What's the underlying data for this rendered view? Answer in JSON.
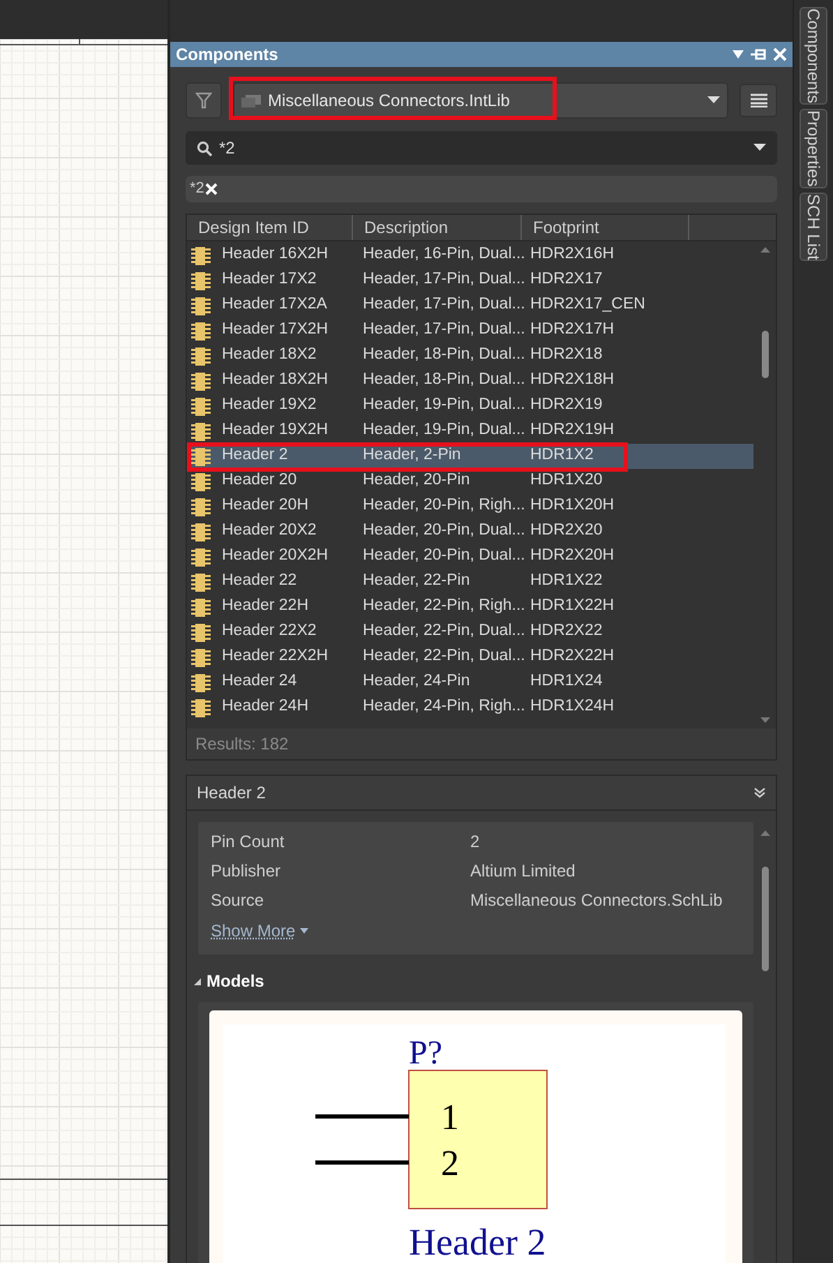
{
  "panel": {
    "title": "Components"
  },
  "library": {
    "value": "Miscellaneous Connectors.IntLib",
    "highlighted": true
  },
  "search": {
    "value": "*2"
  },
  "filter_chips": [
    {
      "label": "*2"
    }
  ],
  "table": {
    "columns": [
      "Design Item ID",
      "Description",
      "Footprint"
    ],
    "rows": [
      {
        "id": "Header 16X2H",
        "description": "Header, 16-Pin, Dual...",
        "footprint": "HDR2X16H",
        "selected": false,
        "highlighted": false
      },
      {
        "id": "Header 17X2",
        "description": "Header, 17-Pin, Dual...",
        "footprint": "HDR2X17",
        "selected": false,
        "highlighted": false
      },
      {
        "id": "Header 17X2A",
        "description": "Header, 17-Pin, Dual...",
        "footprint": "HDR2X17_CEN",
        "selected": false,
        "highlighted": false
      },
      {
        "id": "Header 17X2H",
        "description": "Header, 17-Pin, Dual...",
        "footprint": "HDR2X17H",
        "selected": false,
        "highlighted": false
      },
      {
        "id": "Header 18X2",
        "description": "Header, 18-Pin, Dual...",
        "footprint": "HDR2X18",
        "selected": false,
        "highlighted": false
      },
      {
        "id": "Header 18X2H",
        "description": "Header, 18-Pin, Dual...",
        "footprint": "HDR2X18H",
        "selected": false,
        "highlighted": false
      },
      {
        "id": "Header 19X2",
        "description": "Header, 19-Pin, Dual...",
        "footprint": "HDR2X19",
        "selected": false,
        "highlighted": false
      },
      {
        "id": "Header 19X2H",
        "description": "Header, 19-Pin, Dual...",
        "footprint": "HDR2X19H",
        "selected": false,
        "highlighted": false
      },
      {
        "id": "Header 2",
        "description": "Header, 2-Pin",
        "footprint": "HDR1X2",
        "selected": true,
        "highlighted": true
      },
      {
        "id": "Header 20",
        "description": "Header, 20-Pin",
        "footprint": "HDR1X20",
        "selected": false,
        "highlighted": false
      },
      {
        "id": "Header 20H",
        "description": "Header, 20-Pin, Righ...",
        "footprint": "HDR1X20H",
        "selected": false,
        "highlighted": false
      },
      {
        "id": "Header 20X2",
        "description": "Header, 20-Pin, Dual...",
        "footprint": "HDR2X20",
        "selected": false,
        "highlighted": false
      },
      {
        "id": "Header 20X2H",
        "description": "Header, 20-Pin, Dual...",
        "footprint": "HDR2X20H",
        "selected": false,
        "highlighted": false
      },
      {
        "id": "Header 22",
        "description": "Header, 22-Pin",
        "footprint": "HDR1X22",
        "selected": false,
        "highlighted": false
      },
      {
        "id": "Header 22H",
        "description": "Header, 22-Pin, Righ...",
        "footprint": "HDR1X22H",
        "selected": false,
        "highlighted": false
      },
      {
        "id": "Header 22X2",
        "description": "Header, 22-Pin, Dual...",
        "footprint": "HDR2X22",
        "selected": false,
        "highlighted": false
      },
      {
        "id": "Header 22X2H",
        "description": "Header, 22-Pin, Dual...",
        "footprint": "HDR2X22H",
        "selected": false,
        "highlighted": false
      },
      {
        "id": "Header 24",
        "description": "Header, 24-Pin",
        "footprint": "HDR1X24",
        "selected": false,
        "highlighted": false
      },
      {
        "id": "Header 24H",
        "description": "Header, 24-Pin, Righ...",
        "footprint": "HDR1X24H",
        "selected": false,
        "highlighted": false
      }
    ]
  },
  "results": "Results: 182",
  "details": {
    "title": "Header 2",
    "properties": [
      {
        "name": "Pin Count",
        "value": "2"
      },
      {
        "name": "Publisher",
        "value": "Altium Limited"
      },
      {
        "name": "Source",
        "value": "Miscellaneous Connectors.SchLib"
      }
    ],
    "show_more": "Show More",
    "models_heading": "Models",
    "symbol": {
      "designator": "P?",
      "pins": [
        "1",
        "2"
      ],
      "comment": "Header 2"
    }
  },
  "side_tabs": [
    "Components",
    "Properties",
    "SCH List"
  ]
}
